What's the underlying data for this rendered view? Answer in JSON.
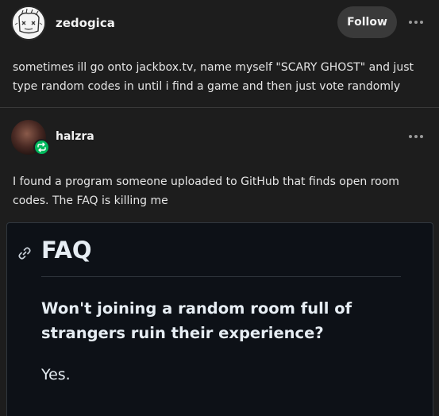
{
  "post": {
    "author": "zedogica",
    "follow_label": "Follow",
    "body": "sometimes ill go onto jackbox.tv, name myself \"SCARY GHOST\" and just type random codes in until i find a game and then just vote randomly"
  },
  "reblog": {
    "author": "halzra",
    "body": "I found a program someone uploaded to GitHub that finds open room codes. The FAQ is killing me",
    "image": {
      "heading": "FAQ",
      "question": "Won't joining a random room full of strangers ruin their experience?",
      "answer": "Yes."
    }
  },
  "icons": {
    "menu": "more-icon",
    "reblog": "reblog-icon",
    "link": "link-icon"
  },
  "colors": {
    "background": "#1d1d1d",
    "reblog_badge": "#00b85c",
    "follow_button": "#3a3a3a",
    "image_background": "#0d1117"
  }
}
